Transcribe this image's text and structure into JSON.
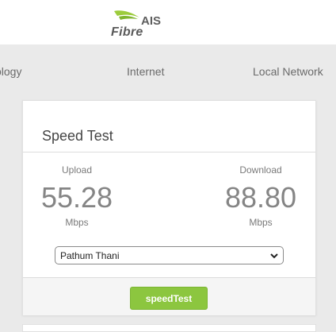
{
  "brand": {
    "name": "AIS",
    "product": "Fibre"
  },
  "nav": {
    "items": [
      "ology",
      "Internet",
      "Local Network"
    ]
  },
  "speed_test": {
    "title": "Speed Test",
    "upload": {
      "label": "Upload",
      "value": "55.28",
      "unit": "Mbps"
    },
    "download": {
      "label": "Download",
      "value": "88.80",
      "unit": "Mbps"
    },
    "server": {
      "selected": "Pathum Thani"
    },
    "button_label": "speedTest"
  },
  "colors": {
    "accent": "#8cc63f",
    "background": "#eaeaea"
  }
}
